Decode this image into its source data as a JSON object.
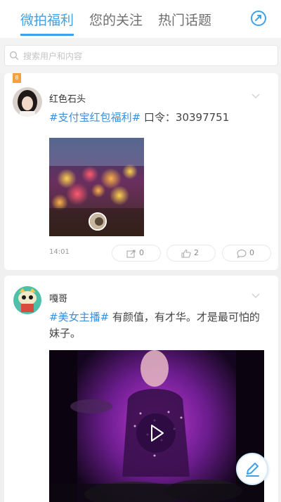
{
  "tabs": [
    {
      "label": "微拍福利",
      "active": true
    },
    {
      "label": "您的关注",
      "active": false
    },
    {
      "label": "热门话题",
      "active": false
    }
  ],
  "search": {
    "placeholder": "搜索用户和内容"
  },
  "colors": {
    "accent": "#3fa1e8",
    "hashtag": "#3d8fd9",
    "badge": "#f0a23c"
  },
  "posts": [
    {
      "badge": "8",
      "username": "红色石头",
      "hashtag": "#支付宝红包福利#",
      "text": " 口令：30397751",
      "timestamp": "14:01",
      "actions": [
        {
          "icon": "share-icon",
          "count": "0"
        },
        {
          "icon": "like-icon",
          "count": "2"
        },
        {
          "icon": "comment-icon",
          "count": "0"
        }
      ]
    },
    {
      "username": "嘎哥",
      "hashtag": "#美女主播#",
      "text": " 有颜值，有才华。才是最可怕的妹子。",
      "media": "video"
    }
  ]
}
